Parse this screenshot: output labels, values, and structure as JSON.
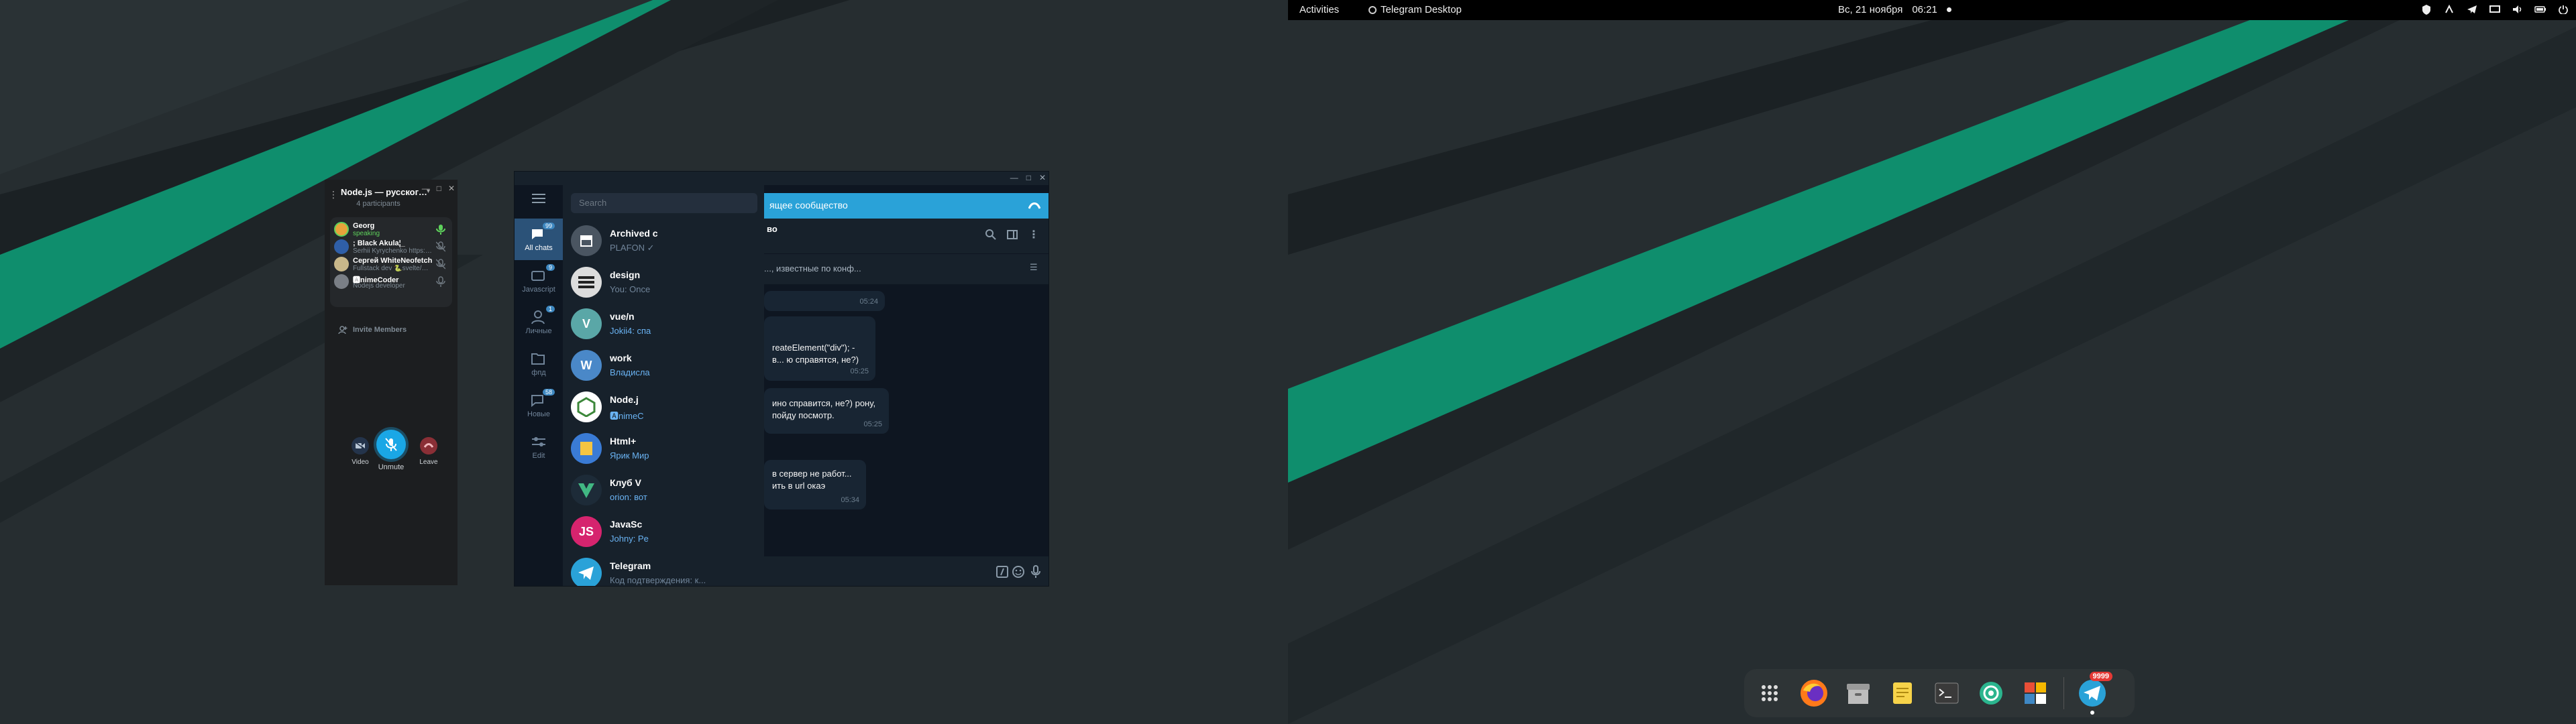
{
  "topbar": {
    "activities": "Activities",
    "app_name": "Telegram Desktop",
    "date": "Вс, 21 ноября",
    "time": "06:21"
  },
  "dock": {
    "items": [
      "apps-grid-icon",
      "firefox-icon",
      "archive-icon",
      "text-editor-icon",
      "terminal-icon",
      "camera-icon",
      "software-icon",
      "telegram-icon"
    ],
    "telegram_badge": "9999"
  },
  "telegram": {
    "search_placeholder": "Search",
    "rail": [
      {
        "label": "All chats",
        "badge": "99"
      },
      {
        "label": "Javascript",
        "badge": "9"
      },
      {
        "label": "Личные",
        "badge": "1"
      },
      {
        "label": "фпд",
        "badge": ""
      },
      {
        "label": "Новые",
        "badge": "58"
      },
      {
        "label": "Edit",
        "badge": ""
      }
    ],
    "chats": [
      {
        "name": "Archived c",
        "last": "PLAFON ✓"
      },
      {
        "name": "design",
        "last": "You: Once"
      },
      {
        "name": "vue/n",
        "last": "Jokii4: спа"
      },
      {
        "name": "work",
        "last": "Владисла"
      },
      {
        "name": "Node.j",
        "last": "🅰nimeC"
      },
      {
        "name": "Html+",
        "last": "Ярик Мир"
      },
      {
        "name": "Клуб V",
        "last": "orion: вот"
      },
      {
        "name": "JavaSc",
        "last": "Johny: Pe"
      },
      {
        "name": "Telegram",
        "last": "Код подтверждения: к..."
      }
    ],
    "avatar_letters": [
      "",
      "",
      "V",
      "W",
      "",
      "",
      "",
      "JS",
      ""
    ],
    "call_banner": "ящее сообщество",
    "chat_header": "во",
    "pinned": "..., известные по конф...",
    "messages": [
      {
        "text": "",
        "time": "05:24"
      },
      {
        "text": "reateElement(\"div\"); - в... ю справятся, не?)",
        "time": "05:25"
      },
      {
        "text": "ино справится, не?) рону, пойду посмотр.",
        "time": "05:25"
      },
      {
        "text": "в сервер не работ... ить в url окаэ",
        "time": "05:34"
      }
    ]
  },
  "voice_chat": {
    "title": "Node.js — русскоговорящее сооб...",
    "participants_count": "4 participants",
    "participants": [
      {
        "name": "Georg",
        "status": "speaking"
      },
      {
        "name": "; Black Akula¦_",
        "status": "Serhii Kyrychenko https://github.com/bl..."
      },
      {
        "name": "Сергей WhiteNeofetch",
        "status": "Fullstack dev 🐍svelte/node.js"
      },
      {
        "name": "🅰nimeCoder",
        "status": "Nodejs developer"
      }
    ],
    "invite_label": "Invite Members",
    "video_label": "Video",
    "unmute_label": "Unmute",
    "leave_label": "Leave"
  },
  "colors": {
    "accent": "#2aa2d8",
    "wallpaper_stripe": "#0d8a6a",
    "leave": "#c43a44"
  }
}
